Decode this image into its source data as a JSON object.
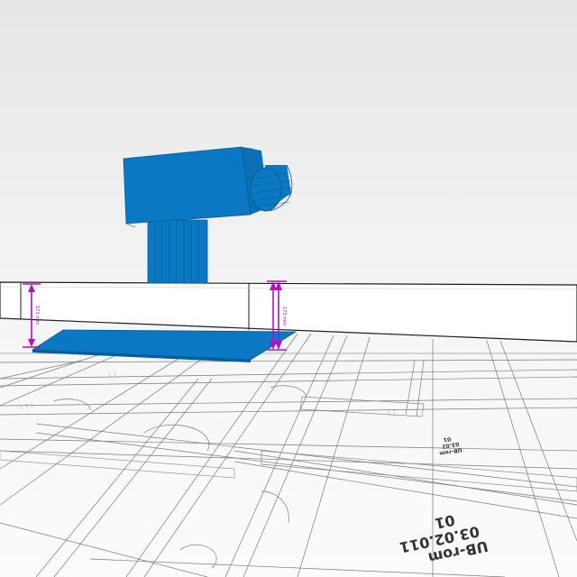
{
  "viewer": {
    "colors": {
      "model_blue": "#0a78c2",
      "model_blue_light": "#1a8fd8",
      "model_blue_dark": "#055e9c",
      "dimension_magenta": "#b010c0",
      "plan_line": "#6a6a6a",
      "wall_outline": "#222222"
    }
  },
  "dimensions": {
    "left": {
      "label": "173 mm"
    },
    "right": {
      "label": "173 mm"
    }
  },
  "floor_plan": {
    "room_labels": [
      "UB-rom",
      "03.02.011",
      "01"
    ],
    "small_label": [
      "UB-rom",
      "03.02",
      "01"
    ]
  }
}
